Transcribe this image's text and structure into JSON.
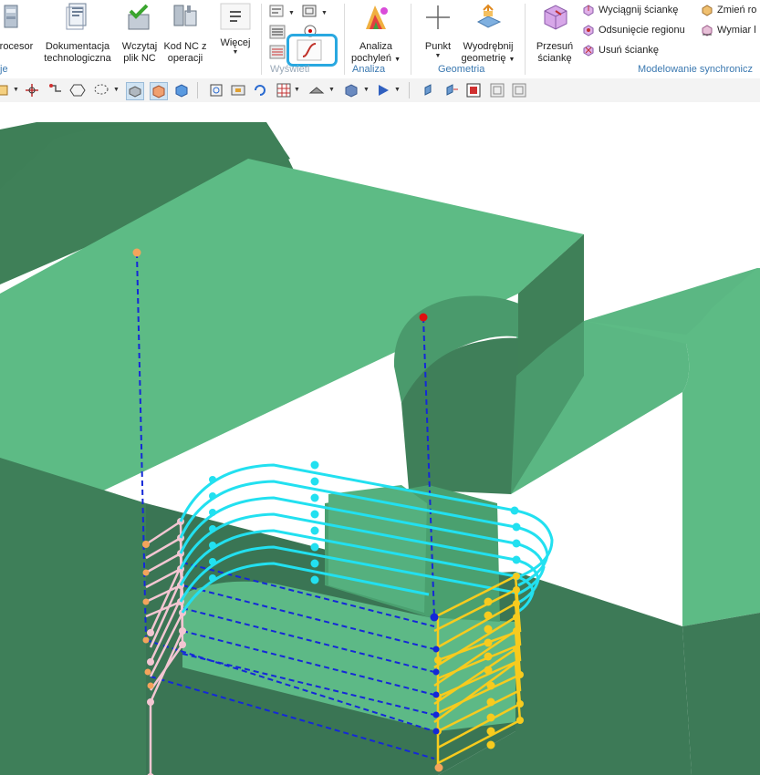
{
  "ribbon": {
    "buttons": [
      {
        "id": "postprocesor",
        "label": "rocesor",
        "label2": ""
      },
      {
        "id": "dokumentacja",
        "label": "Dokumentacja",
        "label2": "technologiczna"
      },
      {
        "id": "wczytaj",
        "label": "Wczytaj",
        "label2": "plik NC"
      },
      {
        "id": "kodnc",
        "label": "Kod NC z",
        "label2": "operacji"
      },
      {
        "id": "wiecej",
        "label": "Więcej",
        "label2": ""
      },
      {
        "id": "analiza",
        "label": "Analiza",
        "label2": "pochyleń"
      },
      {
        "id": "punkt",
        "label": "Punkt",
        "label2": ""
      },
      {
        "id": "wyodrebnij",
        "label": "Wyodrębnij",
        "label2": "geometrię"
      },
      {
        "id": "przesun",
        "label": "Przesuń",
        "label2": "ściankę"
      }
    ],
    "small_buttons": [
      {
        "id": "wyciagnij",
        "label": "Wyciągnij ściankę"
      },
      {
        "id": "odsuniecie",
        "label": "Odsunięcie regionu"
      },
      {
        "id": "usun",
        "label": "Usuń ściankę"
      },
      {
        "id": "zmien",
        "label": "Zmień ro"
      },
      {
        "id": "wymiar",
        "label": "Wymiar l"
      }
    ],
    "groups": {
      "left": "je",
      "wyswietl": "Wyświetl",
      "analiza": "Analiza",
      "geometria": "Geometria",
      "modelowanie": "Modelowanie synchronicz"
    }
  },
  "colors": {
    "model_light": "#5dbb85",
    "model_mid": "#4fa576",
    "model_dark": "#3c7a55",
    "toolpath_cyan": "#22e0f0",
    "toolpath_pink": "#f3c6d2",
    "toolpath_yellow": "#f7cb1e",
    "rapid_blue": "#1428d8",
    "highlight": "#29a8e0"
  },
  "toolbar2": {
    "icons": [
      "view-orient-icon",
      "snap-icon",
      "move-icon",
      "hexagon-icon",
      "lasso-select-icon",
      "shaded-icon",
      "box-icon",
      "cube-icon",
      "zoom-fit-icon",
      "zoom-window-icon",
      "rotate-icon",
      "grid-icon",
      "section-icon",
      "display-style-icon",
      "arrow-icon",
      "color-icon",
      "pan-icon",
      "pan2-icon",
      "stop-icon",
      "frame-icon",
      "frame2-icon"
    ]
  }
}
